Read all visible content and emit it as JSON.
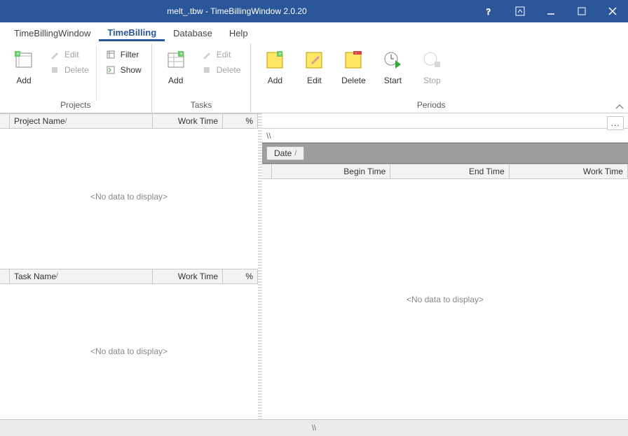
{
  "title": "melt_.tbw - TimeBillingWindow 2.0.20",
  "menu": {
    "tbwin": "TimeBillingWindow",
    "tb": "TimeBilling",
    "db": "Database",
    "help": "Help"
  },
  "ribbon": {
    "projects": {
      "label": "Projects",
      "add": "Add",
      "edit": "Edit",
      "delete": "Delete",
      "filter": "Filter",
      "show": "Show"
    },
    "tasks": {
      "label": "Tasks",
      "add": "Add",
      "edit": "Edit",
      "delete": "Delete"
    },
    "periods": {
      "label": "Periods",
      "add": "Add",
      "edit": "Edit",
      "delete": "Delete",
      "start": "Start",
      "stop": "Stop"
    }
  },
  "panes": {
    "projects": {
      "col1": "Project Name",
      "col2": "Work Time",
      "col3": "%",
      "nodata": "<No data to display>"
    },
    "tasks": {
      "col1": "Task Name",
      "col2": "Work Time",
      "col3": "%",
      "nodata": "<No data to display>"
    },
    "periods": {
      "group": "Date",
      "col1": "Begin Time",
      "col2": "End Time",
      "col3": "Work Time",
      "nodata": "<No data to display>"
    }
  },
  "backslash": "\\\\",
  "statusbar": "\\\\",
  "ellipsis": "..."
}
